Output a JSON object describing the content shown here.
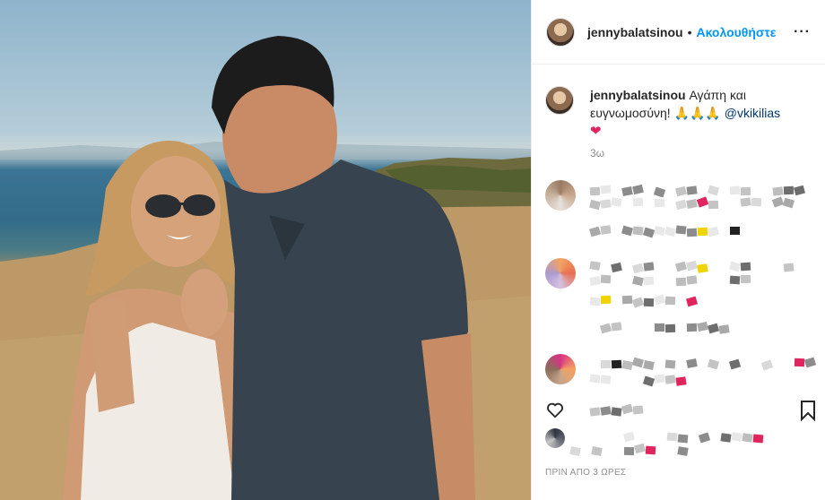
{
  "post": {
    "username": "jennybalatsinou",
    "follow_label": "Ακολουθήστε",
    "separator": "•",
    "more_label": "···",
    "caption": {
      "username": "jennybalatsinou",
      "text": "Αγάπη και ευγνωμοσύνη! 🙏🙏🙏",
      "mention": "@vkikilias",
      "heart": "❤"
    },
    "caption_age": "3ω",
    "post_time": "ΠΡΙΝ ΑΠΟ 3 ΩΡΕΣ"
  },
  "comments": [
    {
      "note": "pixelated"
    },
    {
      "note": "pixelated"
    },
    {
      "note": "pixelated"
    }
  ],
  "colors": {
    "follow": "#0095f6",
    "mention": "#00376b",
    "heart": "#e0245e",
    "muted": "#8e8e8e"
  },
  "icons": [
    "heart-outline-icon",
    "bookmark-icon",
    "more-icon"
  ]
}
